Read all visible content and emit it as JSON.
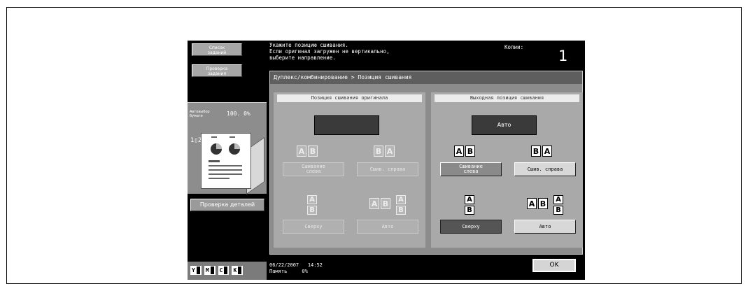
{
  "left_panel": {
    "job_list_label": [
      "Список",
      "заданий"
    ],
    "job_check_label": [
      "Проверка",
      "задания"
    ],
    "auto_paper_label": [
      "Автовыбор",
      "бумаги"
    ],
    "zoom": "100. 0%",
    "pages_indicator": "1▯2",
    "detail_check_label": "Проверка деталей",
    "toner": [
      {
        "letter": "Y"
      },
      {
        "letter": "M"
      },
      {
        "letter": "C"
      },
      {
        "letter": "K"
      }
    ]
  },
  "message": {
    "line1": "Укажите позицию сшивания.",
    "line2": "Если оригинал загружен не вертикально,",
    "line3": "выберите направление."
  },
  "copies": {
    "label": "Копии:",
    "value": "1"
  },
  "breadcrumb": "Дуплекс/комбинирование > Позиция сшивания",
  "original_position": {
    "header": "Позиция сшивания оригинала",
    "display": "",
    "left_label": [
      "Сшивание",
      "слева"
    ],
    "right_label": "Сшив. справа",
    "top_label": "Сверху",
    "auto_label": "Авто"
  },
  "output_position": {
    "header": "Выходная позиция сшивания",
    "display": "Авто",
    "left_label": [
      "Сшивание",
      "слева"
    ],
    "right_label": "Сшив. справа",
    "top_label": "Сверху",
    "auto_label": "Авто"
  },
  "status": {
    "date": "06/22/2007",
    "time": "14:52",
    "memory_label": "Память",
    "memory_value": "0%"
  },
  "ok_label": "OK",
  "icon_letters": {
    "a": "A",
    "b": "B"
  }
}
